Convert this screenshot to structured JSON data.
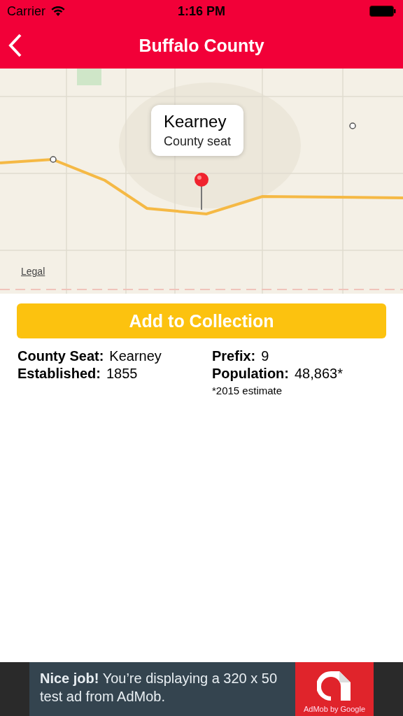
{
  "status_bar": {
    "carrier": "Carrier",
    "time": "1:16 PM"
  },
  "nav": {
    "title": "Buffalo County"
  },
  "map": {
    "kind": "picture",
    "callout": {
      "title": "Kearney",
      "subtitle": "County seat"
    },
    "legal": "Legal"
  },
  "add_button": "Add to Collection",
  "details": [
    {
      "label": "County Seat:",
      "value": "Kearney"
    },
    {
      "label": "Prefix:",
      "value": "9"
    },
    {
      "label": "Established:",
      "value": "1855"
    },
    {
      "label": "Population:",
      "value": "48,863*"
    }
  ],
  "footnote": "*2015 estimate",
  "ad": {
    "text": "**Nice job!** You’re displaying a 320 x 50 test ad from AdMob.",
    "brand": "AdMob by Google"
  }
}
